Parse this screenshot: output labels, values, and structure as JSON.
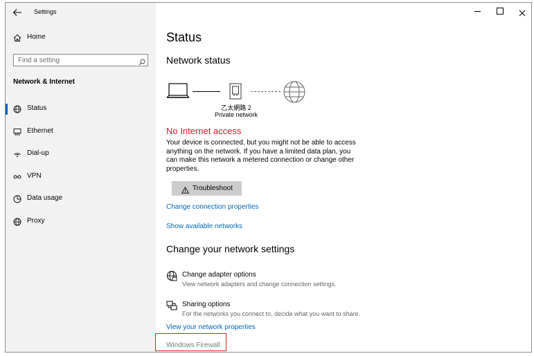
{
  "window": {
    "title": "Settings"
  },
  "sidebar": {
    "home_label": "Home",
    "search_placeholder": "Find a setting",
    "section_title": "Network & Internet",
    "items": [
      {
        "label": "Status",
        "icon": "globe-icon",
        "selected": true
      },
      {
        "label": "Ethernet",
        "icon": "ethernet-icon",
        "selected": false
      },
      {
        "label": "Dial-up",
        "icon": "dialup-icon",
        "selected": false
      },
      {
        "label": "VPN",
        "icon": "vpn-icon",
        "selected": false
      },
      {
        "label": "Data usage",
        "icon": "data-usage-icon",
        "selected": false
      },
      {
        "label": "Proxy",
        "icon": "proxy-globe-icon",
        "selected": false
      }
    ]
  },
  "main": {
    "page_title": "Status",
    "network_status_heading": "Network status",
    "adapter_name": "乙太網路 2",
    "network_profile": "Private network",
    "alert_title": "No Internet access",
    "alert_body": "Your device is connected, but you might not be able to access anything on the network. If you have a limited data plan, you can make this network a metered connection or change other properties.",
    "troubleshoot_label": "Troubleshoot",
    "change_connection_link": "Change connection properties",
    "show_networks_link": "Show available networks",
    "change_settings_heading": "Change your network settings",
    "options": [
      {
        "title": "Change adapter options",
        "desc": "View network adapters and change connection settings."
      },
      {
        "title": "Sharing options",
        "desc": "For the networks you connect to, decide what you want to share."
      }
    ],
    "view_properties_link": "View your network properties",
    "firewall_link": "Windows Firewall"
  },
  "colors": {
    "accent": "#0067b8",
    "alert": "#e81123",
    "sidebar_bg": "#f2f2f2",
    "highlight_box": "#e0201b"
  }
}
